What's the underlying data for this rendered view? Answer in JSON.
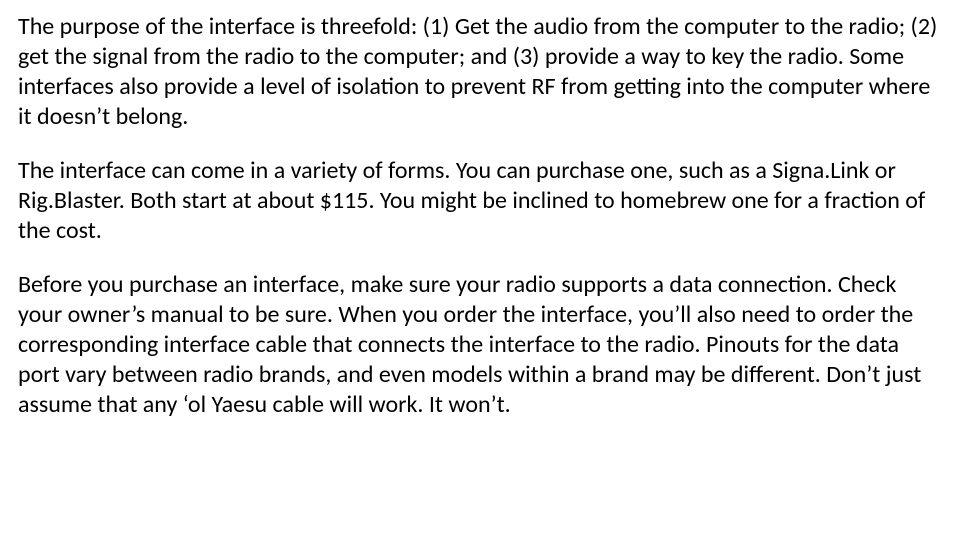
{
  "paragraphs": {
    "p1": "The purpose of the interface is threefold: (1) Get the audio from the computer to the radio; (2) get the signal from the radio to the computer; and (3) provide a way to key the radio.  Some interfaces also provide a level of isolation to prevent RF from getting into the computer where it doesn’t belong.",
    "p2": "The interface can come in a variety of forms.  You can purchase one, such as a Signa.Link or Rig.Blaster.  Both start at about $115.  You might be inclined to homebrew one for a fraction of the cost.",
    "p3": "Before you purchase an interface, make sure your radio supports a data connection.  Check your owner’s manual to be sure.  When you order the interface, you’ll also need to order the corresponding interface cable that connects the interface to the radio.  Pinouts for the data port vary between radio brands, and even models within a brand may be different.  Don’t just assume that any ‘ol Yaesu cable will work. It won’t."
  }
}
